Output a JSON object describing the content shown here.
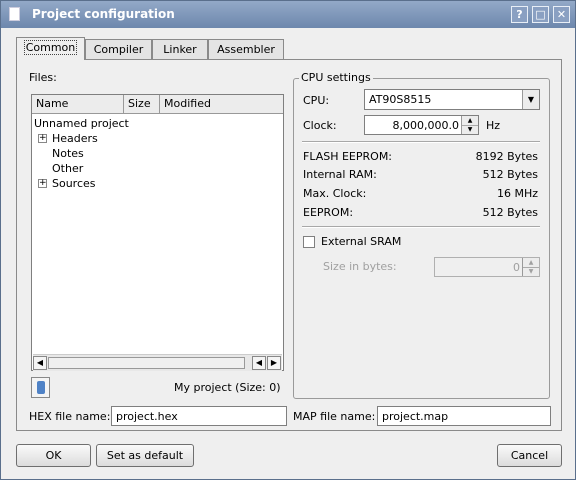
{
  "window": {
    "title": "Project configuration",
    "titlebar_buttons": [
      "?",
      "□",
      "✕"
    ]
  },
  "tabs": [
    {
      "label": "Common",
      "active": true
    },
    {
      "label": "Compiler",
      "active": false
    },
    {
      "label": "Linker",
      "active": false
    },
    {
      "label": "Assembler",
      "active": false
    }
  ],
  "files": {
    "label": "Files:",
    "columns": [
      "Name",
      "Size",
      "Modified"
    ],
    "tree": {
      "root": "Unnamed project",
      "items": [
        {
          "label": "Headers",
          "expandable": true
        },
        {
          "label": "Notes",
          "expandable": false
        },
        {
          "label": "Other",
          "expandable": false
        },
        {
          "label": "Sources",
          "expandable": true
        }
      ]
    },
    "summary": "My project (Size: 0)"
  },
  "cpu": {
    "group_title": "CPU settings",
    "cpu_label": "CPU:",
    "cpu_value": "AT90S8515",
    "clock_label": "Clock:",
    "clock_value": "8,000,000.0",
    "clock_unit": "Hz",
    "info": [
      {
        "label": "FLASH EEPROM:",
        "value": "8192 Bytes"
      },
      {
        "label": "Internal RAM:",
        "value": "512 Bytes"
      },
      {
        "label": "Max. Clock:",
        "value": "16 MHz"
      },
      {
        "label": "EEPROM:",
        "value": "512 Bytes"
      }
    ],
    "external_sram_label": "External SRAM",
    "external_sram_checked": false,
    "size_label": "Size in bytes:",
    "size_value": "0"
  },
  "output": {
    "hex_label": "HEX file name:",
    "hex_value": "project.hex",
    "map_label": "MAP file name:",
    "map_value": "project.map"
  },
  "buttons": {
    "ok": "OK",
    "default": "Set as default",
    "cancel": "Cancel"
  }
}
